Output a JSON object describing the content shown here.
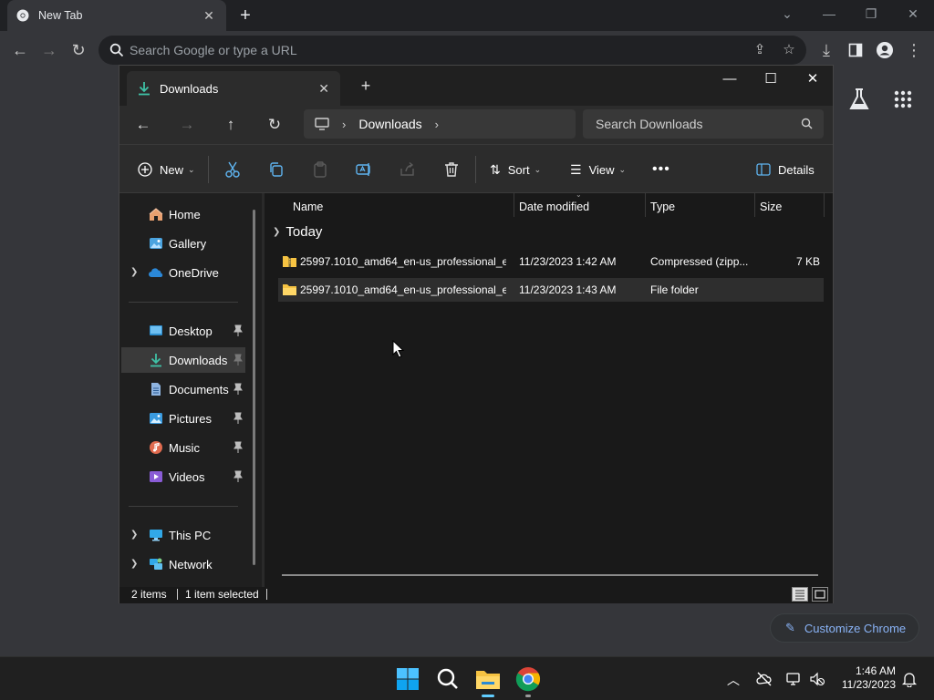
{
  "chrome": {
    "tab_title": "New Tab",
    "omnibox_placeholder": "Search Google or type a URL",
    "customize_label": "Customize Chrome"
  },
  "explorer": {
    "tab_title": "Downloads",
    "breadcrumb_location": "Downloads",
    "search_placeholder": "Search Downloads",
    "commands": {
      "new": "New",
      "sort": "Sort",
      "view": "View",
      "details": "Details"
    },
    "nav": {
      "home": "Home",
      "gallery": "Gallery",
      "onedrive": "OneDrive",
      "desktop": "Desktop",
      "downloads": "Downloads",
      "documents": "Documents",
      "pictures": "Pictures",
      "music": "Music",
      "videos": "Videos",
      "this_pc": "This PC",
      "network": "Network"
    },
    "columns": {
      "name": "Name",
      "date_modified": "Date modified",
      "type": "Type",
      "size": "Size"
    },
    "group_label": "Today",
    "files": [
      {
        "name": "25997.1010_amd64_en-us_professional_e...",
        "date": "11/23/2023 1:42 AM",
        "type": "Compressed (zipp...",
        "size": "7 KB"
      },
      {
        "name": "25997.1010_amd64_en-us_professional_e...",
        "date": "11/23/2023 1:43 AM",
        "type": "File folder",
        "size": ""
      }
    ],
    "status": {
      "items": "2 items",
      "selected": "1 item selected"
    }
  },
  "taskbar": {
    "time": "1:46 AM",
    "date": "11/23/2023"
  },
  "colors": {
    "accent": "#60cdff",
    "link": "#8ab4f8",
    "folder": "#f6c342"
  }
}
